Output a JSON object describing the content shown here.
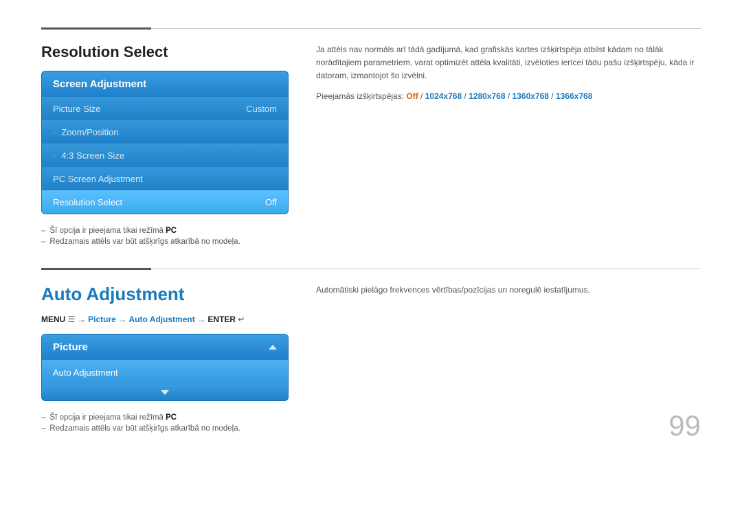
{
  "top_divider": true,
  "section1": {
    "title": "Resolution Select",
    "menu": {
      "header": "Screen Adjustment",
      "items": [
        {
          "label": "Picture Size",
          "value": "Custom",
          "bullet": false,
          "highlighted": false
        },
        {
          "label": "Zoom/Position",
          "value": "",
          "bullet": true,
          "highlighted": false
        },
        {
          "label": "4:3 Screen Size",
          "value": "",
          "bullet": true,
          "highlighted": false
        },
        {
          "label": "PC Screen Adjustment",
          "value": "",
          "bullet": false,
          "highlighted": false
        },
        {
          "label": "Resolution Select",
          "value": "Off",
          "bullet": false,
          "highlighted": true
        }
      ]
    },
    "notes": [
      {
        "text": "Šī opcija ir pieejama tikai režīmā ",
        "bold": "PC"
      },
      {
        "text": "Redzamais attēls var būt atšķirīgs atkarībā no modeļa.",
        "bold": ""
      }
    ],
    "description": "Ja attēls nav normāls arī tādā gadījumā, kad grafiskās kartes izšķirtspēja atbilst kādam no tālāk norādītajiem parametriem, varat optimizēt attēla kvalitāti, izvēloties ierīcei tādu pašu izšķirtspēju, kāda ir datoram, izmantojot šo izvēlni.",
    "available_label": "Pieejamās izšķirtspējas: ",
    "available_off": "Off",
    "available_res": "1024x768 / 1280x768 / 1360x768 / 1366x768"
  },
  "section2": {
    "title": "Auto Adjustment",
    "nav": {
      "menu": "MENU",
      "menu_icon": "☰",
      "arrow1": "→",
      "picture": "Picture",
      "arrow2": "→",
      "adjustment": "Auto Adjustment",
      "arrow3": "→",
      "enter": "ENTER",
      "enter_icon": "↵"
    },
    "menu": {
      "header": "Picture",
      "item": "Auto Adjustment"
    },
    "notes": [
      {
        "text": "Šī opcija ir pieejama tikai režīmā ",
        "bold": "PC"
      },
      {
        "text": "Redzamais attēls var būt atšķirīgs atkarībā no modeļa.",
        "bold": ""
      }
    ],
    "description": "Automātiski pielägo frekvences vērtības/pozīcijas un noregulē iestatījumus."
  },
  "page_number": "99"
}
